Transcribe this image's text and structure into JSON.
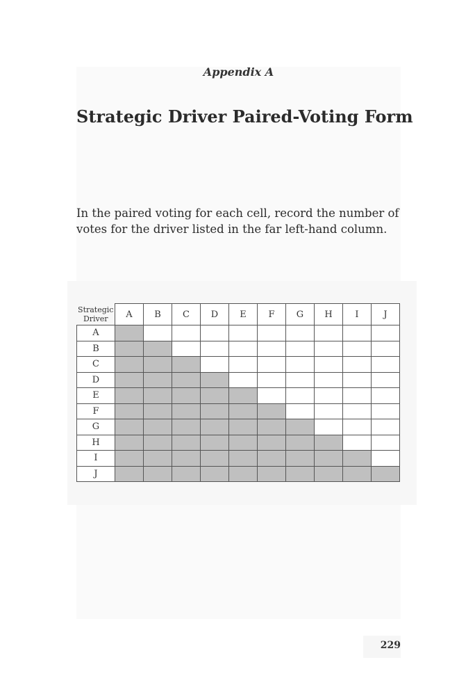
{
  "appendix_label": "Appendix A",
  "title": "Strategic Driver Paired-Voting Form",
  "intro_text": "In the paired voting for each cell, record the number of votes for the driver listed in the far left-hand column.",
  "table": {
    "corner_label": "Strategic Driver",
    "columns": [
      "A",
      "B",
      "C",
      "D",
      "E",
      "F",
      "G",
      "H",
      "I",
      "J"
    ],
    "rows": [
      "A",
      "B",
      "C",
      "D",
      "E",
      "F",
      "G",
      "H",
      "I",
      "J"
    ],
    "shaded_color": "#c0c0c0",
    "shading_rule": "cells on or below the diagonal are shaded"
  },
  "page_number": "229"
}
